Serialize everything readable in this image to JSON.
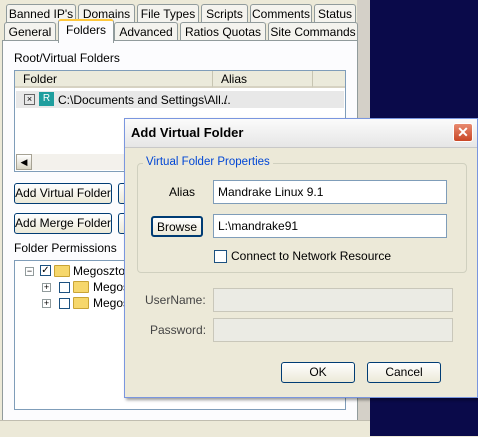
{
  "tabs_row1": [
    "Banned IP's",
    "Domains",
    "File Types",
    "Scripts",
    "Comments",
    "Status"
  ],
  "tabs_row2": [
    "General",
    "Folders",
    "Advanced",
    "Ratios Quotas",
    "Site Commands"
  ],
  "active_tab": "Folders",
  "folders": {
    "section_label": "Root/Virtual Folders",
    "col_folder": "Folder",
    "col_alias": "Alias",
    "row_path": "C:\\Documents and Settings\\All...",
    "row_alias": "/",
    "add_virtual_button": "Add Virtual Folder",
    "add_merge_button": "Add Merge Folder",
    "permissions_label": "Folder Permissions",
    "tree": [
      "Megosztott",
      "Megos",
      "Megos"
    ]
  },
  "dialog": {
    "title": "Add Virtual Folder",
    "group_label": "Virtual Folder Properties",
    "alias_label": "Alias",
    "alias_value": "Mandrake Linux 9.1",
    "browse_button": "Browse",
    "path_value": "L:\\mandrake91",
    "network_checkbox_label": "Connect to Network Resource",
    "username_label": "UserName:",
    "password_label": "Password:",
    "ok_button": "OK",
    "cancel_button": "Cancel"
  },
  "colors": {
    "window_bg": "#ece9d8",
    "desktop": "#0a0a4a",
    "accent_blue": "#0046d5",
    "close_red": "#c94726"
  }
}
